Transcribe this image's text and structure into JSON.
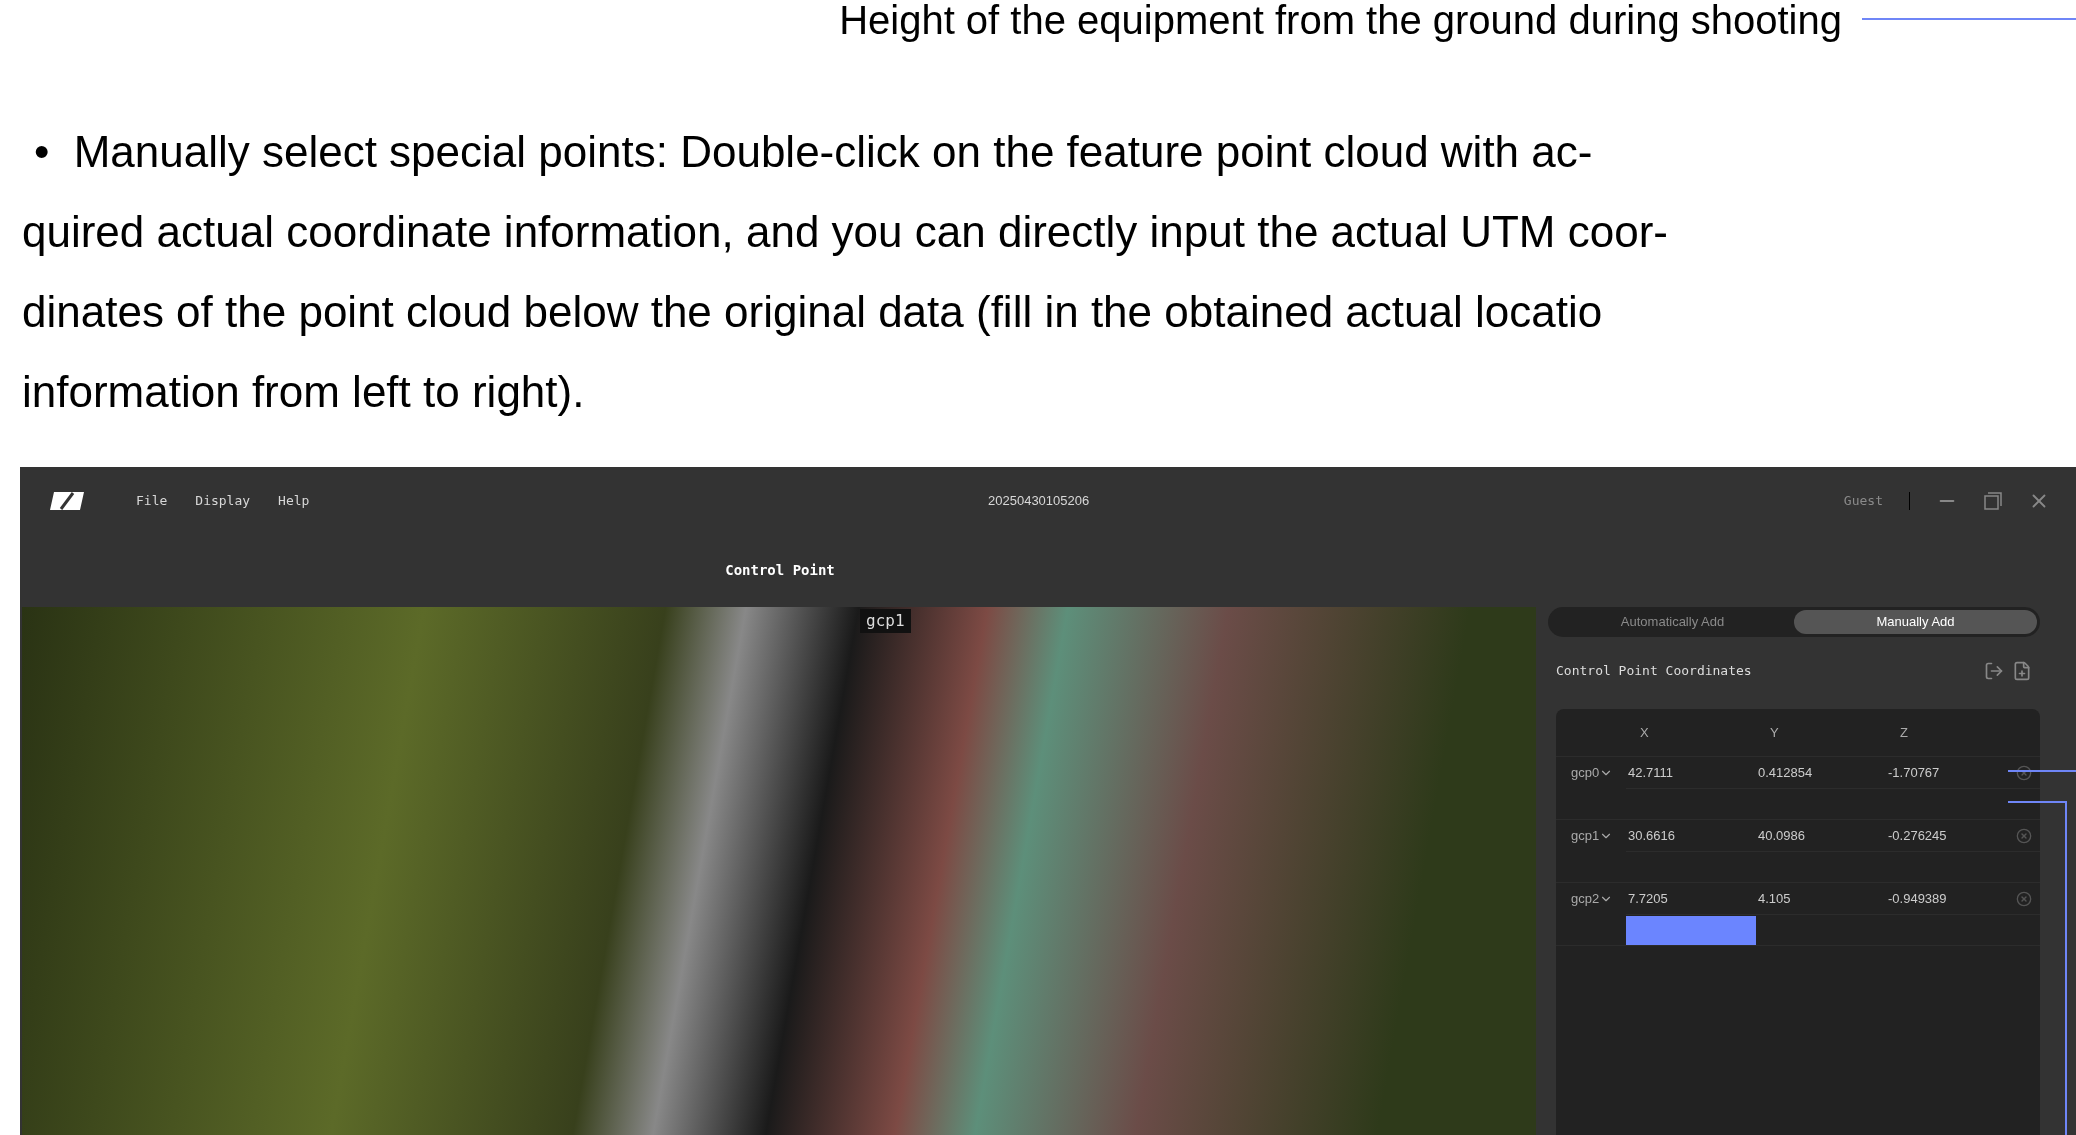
{
  "caption": "Height of the equipment from the ground during shooting",
  "paragraph": {
    "bullet": "•",
    "lines": [
      "Manually select special points: Double-click on the feature point cloud with ac-",
      "quired actual coordinate information, and you can directly input the actual UTM coor-",
      "dinates of the point cloud below the original data (fill in the obtained actual locatio",
      "information from left to right)."
    ]
  },
  "app": {
    "menu": [
      "File",
      "Display",
      "Help"
    ],
    "title": "20250430105206",
    "user": "Guest",
    "panel_title": "Control Point",
    "marker_label": "gcp1",
    "tabs": [
      {
        "label": "Automatically Add",
        "selected": false
      },
      {
        "label": "Manually Add",
        "selected": true
      }
    ],
    "section_title": "Control Point Coordinates",
    "table": {
      "columns": [
        "X",
        "Y",
        "Z"
      ],
      "rows": [
        {
          "name": "gcp0",
          "values": [
            "42.7111",
            "0.412854",
            "-1.70767"
          ]
        },
        {
          "name": "gcp1",
          "values": [
            "30.6616",
            "40.0986",
            "-0.276245"
          ]
        },
        {
          "name": "gcp2",
          "values": [
            "7.7205",
            "4.105",
            "-0.949389"
          ]
        }
      ]
    }
  }
}
